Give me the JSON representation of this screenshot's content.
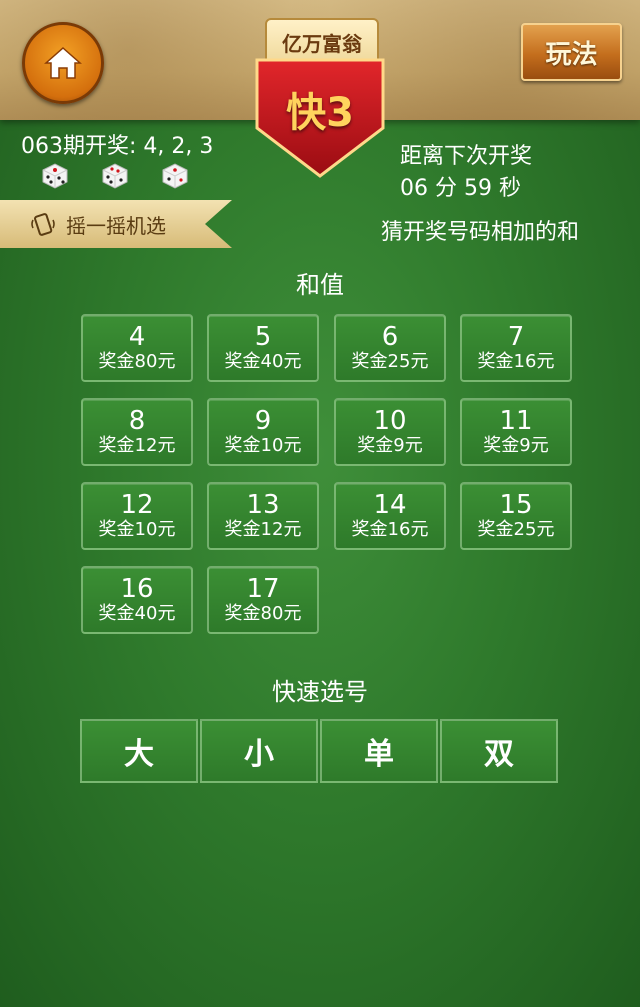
{
  "header": {
    "home_icon": "home-icon",
    "badge_top": "亿万富翁",
    "badge_title": "快3",
    "play_button": "玩法",
    "colors": {
      "accent_red": "#c8141a",
      "gold": "#ffd35d",
      "felt_green": "#2f7a2c"
    }
  },
  "draw": {
    "last_result": "063期开奖: 4, 2, 3",
    "dice": [
      {
        "icon": "die-4-icon",
        "value": 4
      },
      {
        "icon": "die-2-icon",
        "value": 2
      },
      {
        "icon": "die-3-icon",
        "value": 3
      }
    ],
    "countdown_label": "距离下次开奖",
    "countdown_time": "06 分 59 秒"
  },
  "shake": {
    "icon": "phone-shake-icon",
    "label": "摇一摇机选"
  },
  "rule_text": "猜开奖号码相加的和",
  "sum_section": {
    "title": "和值",
    "options": [
      {
        "num": "4",
        "prize": "奖金80元"
      },
      {
        "num": "5",
        "prize": "奖金40元"
      },
      {
        "num": "6",
        "prize": "奖金25元"
      },
      {
        "num": "7",
        "prize": "奖金16元"
      },
      {
        "num": "8",
        "prize": "奖金12元"
      },
      {
        "num": "9",
        "prize": "奖金10元"
      },
      {
        "num": "10",
        "prize": "奖金9元"
      },
      {
        "num": "11",
        "prize": "奖金9元"
      },
      {
        "num": "12",
        "prize": "奖金10元"
      },
      {
        "num": "13",
        "prize": "奖金12元"
      },
      {
        "num": "14",
        "prize": "奖金16元"
      },
      {
        "num": "15",
        "prize": "奖金25元"
      },
      {
        "num": "16",
        "prize": "奖金40元"
      },
      {
        "num": "17",
        "prize": "奖金80元"
      }
    ]
  },
  "quick_section": {
    "title": "快速选号",
    "options": [
      "大",
      "小",
      "单",
      "双"
    ]
  }
}
